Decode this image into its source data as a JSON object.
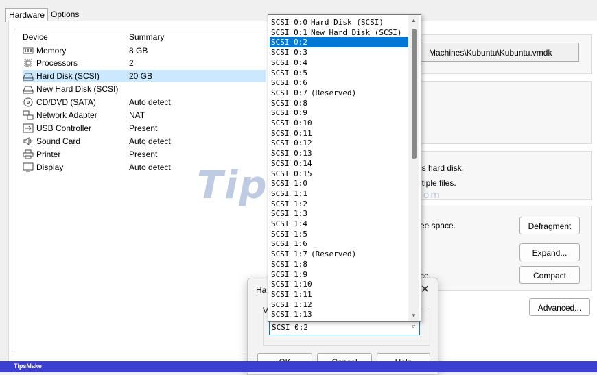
{
  "tabs": [
    {
      "label": "Hardware"
    },
    {
      "label": "Options"
    }
  ],
  "devices": {
    "header": {
      "device": "Device",
      "summary": "Summary"
    },
    "rows": [
      {
        "icon": "memory-icon",
        "name": "Memory",
        "summary": "8 GB"
      },
      {
        "icon": "processor-icon",
        "name": "Processors",
        "summary": "2"
      },
      {
        "icon": "hard-disk-icon",
        "name": "Hard Disk (SCSI)",
        "summary": "20 GB"
      },
      {
        "icon": "hard-disk-icon",
        "name": "New Hard Disk (SCSI)",
        "summary": ""
      },
      {
        "icon": "cd-dvd-icon",
        "name": "CD/DVD (SATA)",
        "summary": "Auto detect"
      },
      {
        "icon": "network-icon",
        "name": "Network Adapter",
        "summary": "NAT"
      },
      {
        "icon": "usb-icon",
        "name": "USB Controller",
        "summary": "Present"
      },
      {
        "icon": "sound-icon",
        "name": "Sound Card",
        "summary": "Auto detect"
      },
      {
        "icon": "printer-icon",
        "name": "Printer",
        "summary": "Present"
      },
      {
        "icon": "display-icon",
        "name": "Display",
        "summary": "Auto detect"
      }
    ]
  },
  "right": {
    "disk_file": "Machines\\Kubuntu\\Kubuntu.vmdk",
    "info_line1": "is hard disk.",
    "info_line2": "ltiple files.",
    "defrag_text": "ee space.",
    "compact_text": "ce.",
    "defragment_label": "Defragment",
    "expand_label": "Expand...",
    "compact_label": "Compact",
    "advanced_label": "Advanced..."
  },
  "watermark": {
    "text": "TipsMake",
    "suffix": ".com"
  },
  "dialog": {
    "title_partial": "Ha",
    "label_partial": "Vi",
    "close_symbol": "✕",
    "combo_value": "SCSI 0:2",
    "ok_label": "OK",
    "cancel_label": "Cancel",
    "help_label": "Help"
  },
  "dropdown": {
    "selected_index": 2,
    "items": [
      {
        "node": "SCSI 0:0",
        "note": "Hard Disk (SCSI)"
      },
      {
        "node": "SCSI 0:1",
        "note": "New Hard Disk (SCSI)"
      },
      {
        "node": "SCSI 0:2",
        "note": ""
      },
      {
        "node": "SCSI 0:3",
        "note": ""
      },
      {
        "node": "SCSI 0:4",
        "note": ""
      },
      {
        "node": "SCSI 0:5",
        "note": ""
      },
      {
        "node": "SCSI 0:6",
        "note": ""
      },
      {
        "node": "SCSI 0:7",
        "note": "(Reserved)"
      },
      {
        "node": "SCSI 0:8",
        "note": ""
      },
      {
        "node": "SCSI 0:9",
        "note": ""
      },
      {
        "node": "SCSI 0:10",
        "note": ""
      },
      {
        "node": "SCSI 0:11",
        "note": ""
      },
      {
        "node": "SCSI 0:12",
        "note": ""
      },
      {
        "node": "SCSI 0:13",
        "note": ""
      },
      {
        "node": "SCSI 0:14",
        "note": ""
      },
      {
        "node": "SCSI 0:15",
        "note": ""
      },
      {
        "node": "SCSI 1:0",
        "note": ""
      },
      {
        "node": "SCSI 1:1",
        "note": ""
      },
      {
        "node": "SCSI 1:2",
        "note": ""
      },
      {
        "node": "SCSI 1:3",
        "note": ""
      },
      {
        "node": "SCSI 1:4",
        "note": ""
      },
      {
        "node": "SCSI 1:5",
        "note": ""
      },
      {
        "node": "SCSI 1:6",
        "note": ""
      },
      {
        "node": "SCSI 1:7",
        "note": "(Reserved)"
      },
      {
        "node": "SCSI 1:8",
        "note": ""
      },
      {
        "node": "SCSI 1:9",
        "note": ""
      },
      {
        "node": "SCSI 1:10",
        "note": ""
      },
      {
        "node": "SCSI 1:11",
        "note": ""
      },
      {
        "node": "SCSI 1:12",
        "note": ""
      },
      {
        "node": "SCSI 1:13",
        "note": ""
      }
    ]
  },
  "footer": {
    "brand": "TipsMake"
  },
  "colors": {
    "selection": "#0078d7",
    "row_selection": "#cce8ff",
    "footer": "#3b3fd1",
    "focus": "#0078d4"
  }
}
